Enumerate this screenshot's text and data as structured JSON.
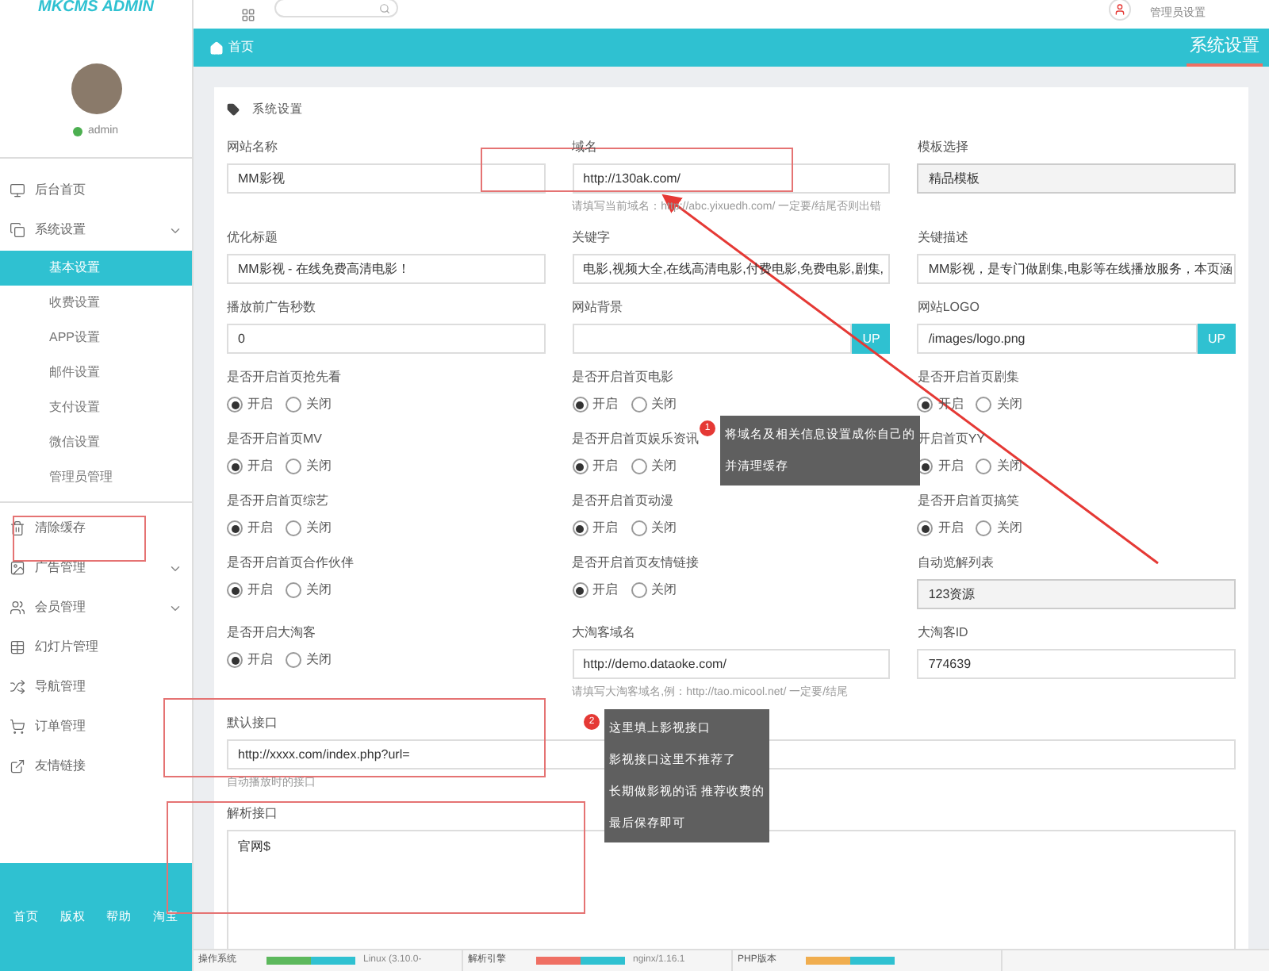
{
  "header": {
    "logo": "MKCMS ADMIN",
    "user_menu": "管理员设置"
  },
  "sidebar": {
    "user": "admin",
    "items": [
      {
        "label": "后台首页"
      },
      {
        "label": "系统设置",
        "expanded": true,
        "children": [
          {
            "label": "基本设置",
            "selected": true
          },
          {
            "label": "收费设置",
            "selected": false
          },
          {
            "label": "APP设置",
            "selected": false
          },
          {
            "label": "邮件设置",
            "selected": false
          },
          {
            "label": "支付设置",
            "selected": false
          },
          {
            "label": "微信设置",
            "selected": false
          },
          {
            "label": "管理员管理",
            "selected": false
          }
        ]
      },
      {
        "label": "清除缓存"
      },
      {
        "label": "广告管理",
        "expanded": false
      },
      {
        "label": "会员管理",
        "expanded": false
      },
      {
        "label": "幻灯片管理"
      },
      {
        "label": "导航管理"
      },
      {
        "label": "订单管理"
      },
      {
        "label": "友情链接"
      }
    ],
    "footer_links": [
      "首页",
      "版权",
      "帮助",
      "淘宝"
    ]
  },
  "breadcrumb": {
    "home": "首页",
    "page_title": "系统设置"
  },
  "card": {
    "title": "系统设置",
    "fields": [
      {
        "kind": "text",
        "label": "网站名称",
        "value": "MM影视"
      },
      {
        "kind": "text",
        "label": "域名",
        "value": "http://130ak.com/",
        "help": "请填写当前域名：http://abc.yixuedh.com/ 一定要/结尾否则出错"
      },
      {
        "kind": "readonly",
        "label": "模板选择",
        "value": "精品模板"
      },
      {
        "kind": "text",
        "label": "优化标题",
        "value": "MM影视 - 在线免费高清电影！"
      },
      {
        "kind": "text",
        "label": "关键字",
        "value": "电影,视频大全,在线高清电影,付费电影,免费电影,剧集,"
      },
      {
        "kind": "text",
        "label": "关键描述",
        "value": "MM影视，是专门做剧集,电影等在线播放服务，本页涵"
      },
      {
        "kind": "text",
        "label": "播放前广告秒数",
        "value": "0"
      },
      {
        "kind": "upload",
        "label": "网站背景",
        "button": "UP"
      },
      {
        "kind": "upload",
        "label": "网站LOGO",
        "value": "/images/logo.png",
        "button": "UP"
      },
      {
        "kind": "radio",
        "label": "是否开启首页抢先看",
        "options": [
          {
            "label": "开启",
            "selected": true
          },
          {
            "label": "关闭",
            "selected": false
          }
        ]
      },
      {
        "kind": "radio",
        "label": "是否开启首页电影",
        "options": [
          {
            "label": "开启",
            "selected": true
          },
          {
            "label": "关闭",
            "selected": false
          }
        ]
      },
      {
        "kind": "radio",
        "label": "是否开启首页剧集",
        "options": [
          {
            "label": "开启",
            "selected": true
          },
          {
            "label": "关闭",
            "selected": false
          }
        ]
      },
      {
        "kind": "radio",
        "label": "是否开启首页MV",
        "options": [
          {
            "label": "开启",
            "selected": true
          },
          {
            "label": "关闭",
            "selected": false
          }
        ]
      },
      {
        "kind": "radio",
        "label": "是否开启首页娱乐资讯",
        "options": [
          {
            "label": "开启",
            "selected": true
          },
          {
            "label": "关闭",
            "selected": false
          }
        ]
      },
      {
        "kind": "radio",
        "label": "开启首页YY",
        "options": [
          {
            "label": "开启",
            "selected": true
          },
          {
            "label": "关闭",
            "selected": false
          }
        ]
      },
      {
        "kind": "radio",
        "label": "是否开启首页综艺",
        "options": [
          {
            "label": "开启",
            "selected": true
          },
          {
            "label": "关闭",
            "selected": false
          }
        ]
      },
      {
        "kind": "radio",
        "label": "是否开启首页动漫",
        "options": [
          {
            "label": "开启",
            "selected": true
          },
          {
            "label": "关闭",
            "selected": false
          }
        ]
      },
      {
        "kind": "radio",
        "label": "是否开启首页搞笑",
        "options": [
          {
            "label": "开启",
            "selected": true
          },
          {
            "label": "关闭",
            "selected": false
          }
        ]
      },
      {
        "kind": "radio",
        "label": "是否开启首页合作伙伴",
        "options": [
          {
            "label": "开启",
            "selected": true
          },
          {
            "label": "关闭",
            "selected": false
          }
        ]
      },
      {
        "kind": "radio",
        "label": "是否开启首页友情链接",
        "options": [
          {
            "label": "开启",
            "selected": true
          },
          {
            "label": "关闭",
            "selected": false
          }
        ]
      },
      {
        "kind": "readonly",
        "label": "自动览解列表",
        "value": "123资源"
      },
      {
        "kind": "radio",
        "label": "是否开启大淘客",
        "options": [
          {
            "label": "开启",
            "selected": true
          },
          {
            "label": "关闭",
            "selected": false
          }
        ]
      },
      {
        "kind": "text",
        "label": "大淘客域名",
        "value": "http://demo.dataoke.com/",
        "help": "请填写大淘客域名,例：http://tao.micool.net/ 一定要/结尾"
      },
      {
        "kind": "text",
        "label": "大淘客ID",
        "value": "774639"
      },
      {
        "kind": "wide",
        "label": "默认接口",
        "value": "http://xxxx.com/index.php?url=",
        "help": "自动播放时的接口"
      },
      {
        "kind": "textarea",
        "label": "解析接口",
        "value": "官网$"
      }
    ]
  },
  "callouts": [
    {
      "number": "1",
      "lines": [
        "将域名及相关信息设置成你自己的",
        "并清理缓存"
      ]
    },
    {
      "number": "2",
      "lines": [
        "这里填上影视接口",
        "影视接口这里不推荐了",
        "长期做影视的话 推荐收费的",
        "最后保存即可"
      ]
    }
  ],
  "status_bar": [
    {
      "label": "操作系统",
      "value": "Linux (3.10.0-",
      "color": "#5cb85c"
    },
    {
      "label": "解析引擎",
      "value": "nginx/1.16.1",
      "color": "#ef6f63"
    },
    {
      "label": "PHP版本",
      "color": "#f0ad4e"
    }
  ]
}
